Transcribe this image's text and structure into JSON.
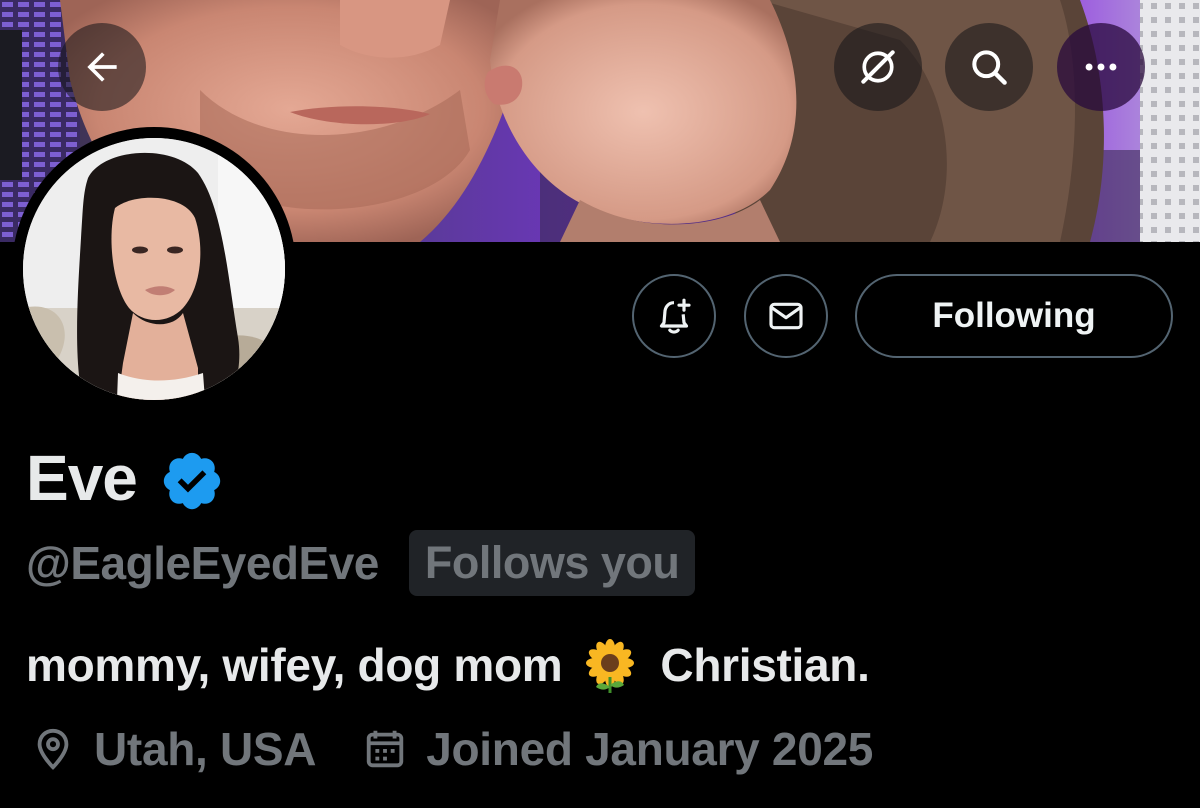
{
  "header": {
    "back_icon": "arrow-left-icon",
    "grok_icon": "grok-icon",
    "search_icon": "search-icon",
    "more_icon": "more-horizontal-icon"
  },
  "actions": {
    "notify_icon": "bell-plus-icon",
    "message_icon": "envelope-icon",
    "following_label": "Following"
  },
  "profile": {
    "display_name": "Eve",
    "handle": "@EagleEyedEve",
    "follows_you": "Follows you",
    "bio_text": "mommy, wifey, dog mom",
    "bio_emoji": "🌻",
    "bio_tail": "Christian.",
    "location": "Utah, USA",
    "joined": "Joined January 2025"
  },
  "colors": {
    "background": "#000000",
    "primary_text": "#e7e9ea",
    "secondary_text": "#71767b",
    "verified_blue": "#1d9bf0",
    "badge_bg": "#202327",
    "border": "#536471"
  }
}
